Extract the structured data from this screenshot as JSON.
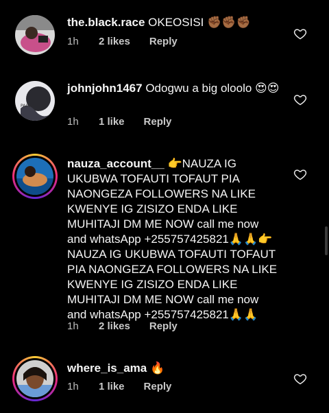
{
  "comments": [
    {
      "username": "the.black.race",
      "text": "OKEOSISI ✊🏾✊🏾✊🏾",
      "time": "1h",
      "likes": "2 likes",
      "reply": "Reply"
    },
    {
      "username": "johnjohn1467",
      "text": "Odogwu a big oloolo 😍😍",
      "time": "1h",
      "likes": "1 like",
      "reply": "Reply"
    },
    {
      "username": "nauza_account__",
      "text": "👉NAUZA IG UKUBWA TOFAUTI TOFAUT PIA NAONGEZA FOLLOWERS  NA LIKE KWENYE IG ZISIZO ENDA LIKE MUHITAJI DM ME NOW call me now and whatsApp +255757425821🙏🙏👉NAUZA IG UKUBWA TOFAUTI TOFAUT PIA NAONGEZA FOLLOWERS  NA LIKE KWENYE IG ZISIZO ENDA LIKE MUHITAJI DM ME NOW call me now and whatsApp +255757425821🙏🙏",
      "time": "1h",
      "likes": "2 likes",
      "reply": "Reply"
    },
    {
      "username": "where_is_ama",
      "text": "🔥",
      "time": "1h",
      "likes": "1 like",
      "reply": "Reply"
    }
  ],
  "icons": {
    "like": "heart-outline-icon"
  },
  "colors": {
    "background": "#000000",
    "text": "#f5f5f5",
    "meta": "#c9c9c9",
    "story_ring": "#ee2a7b"
  }
}
